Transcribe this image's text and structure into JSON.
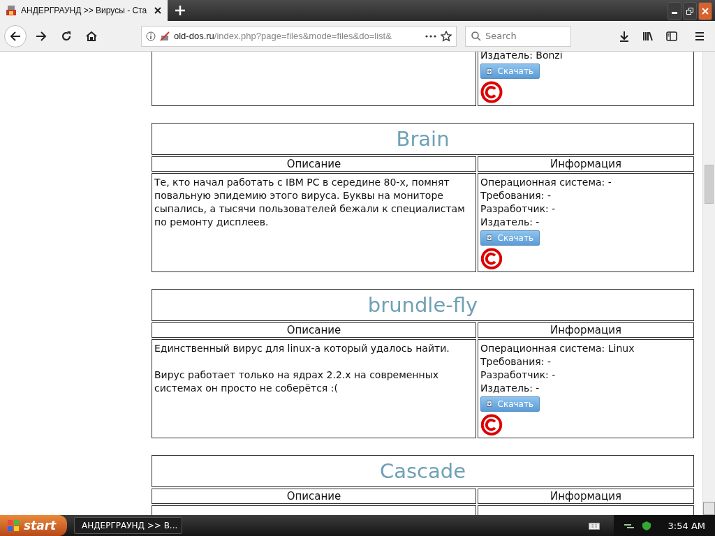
{
  "tab": {
    "title": "АНДЕРГРАУНД >> Вирусы - Ста",
    "selected": true
  },
  "address": {
    "host": "old-dos.ru",
    "path": "/index.php?page=files&mode=files&do=list&"
  },
  "search": {
    "placeholder": "Search"
  },
  "entries": [
    {
      "info": [
        "Издатель: Bonzi"
      ],
      "download": "Скачать"
    },
    {
      "title": "Brain",
      "headers": [
        "Описание",
        "Информация"
      ],
      "description": [
        "Те, кто начал работать с IBM PC в середине 80-х, помнят повальную эпидемию этого вируса. Буквы на мониторе сыпались, а тысячи пользователей бежали к специалистам по ремонту дисплеев."
      ],
      "info": [
        "Операционная система: -",
        "Требования: -",
        "Разработчик: -",
        "Издатель: -"
      ],
      "download": "Скачать"
    },
    {
      "title": "brundle-fly",
      "headers": [
        "Описание",
        "Информация"
      ],
      "description": [
        "Единственный вирус для linux-а который удалось найти.",
        "Вирус работает только на ядрах 2.2.x на современных системах он просто не соберётся :("
      ],
      "info": [
        "Операционная система: Linux",
        "Требования: -",
        "Разработчик: -",
        "Издатель: -"
      ],
      "download": "Скачать"
    },
    {
      "title": "Cascade",
      "headers": [
        "Описание",
        "Информация"
      ]
    }
  ],
  "taskbar": {
    "start": "start",
    "task": "АНДЕРГРАУНД >> В...",
    "clock": "3:54 AM"
  }
}
